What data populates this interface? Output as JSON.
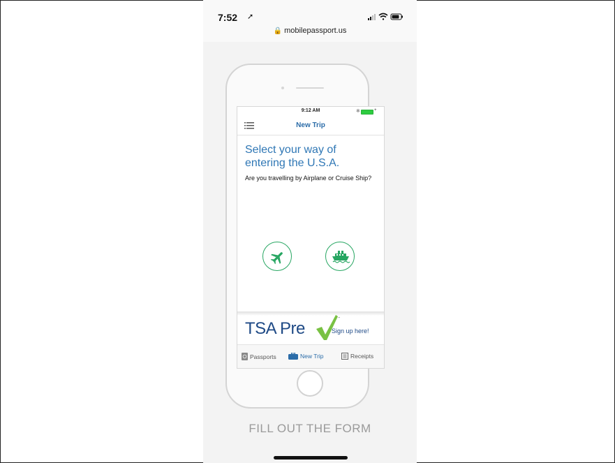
{
  "device_status": {
    "time": "7:52",
    "location_icon": "location-arrow-icon",
    "url": "mobilepassport.us"
  },
  "app": {
    "status_time": "9:12 AM",
    "nav_title": "New Trip",
    "headline": "Select your way of entering the U.S.A.",
    "subtext": "Are you travelling by Airplane or Cruise Ship?",
    "choices": [
      {
        "icon": "airplane-icon"
      },
      {
        "icon": "cruise-ship-icon"
      }
    ],
    "banner": {
      "brand": "TSA Pre",
      "trademark": "™",
      "cta": "Sign up here!"
    },
    "tabs": [
      {
        "label": "Passports",
        "icon": "passport-icon"
      },
      {
        "label": "New Trip",
        "icon": "suitcase-icon"
      },
      {
        "label": "Receipts",
        "icon": "receipt-icon"
      }
    ],
    "colors": {
      "accent_blue": "#2f77b5",
      "brand_green": "#27a662",
      "tsa_navy": "#1f4a86"
    }
  },
  "caption": "FILL OUT THE FORM"
}
